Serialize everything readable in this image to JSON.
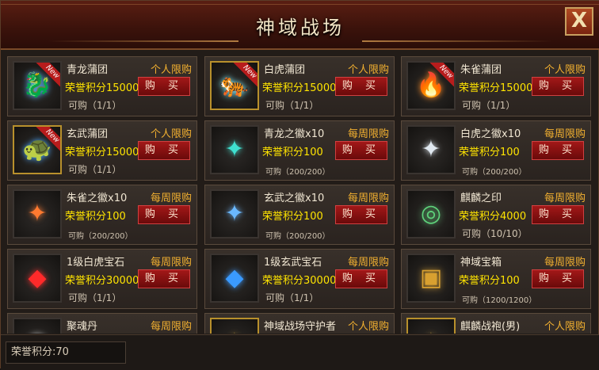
{
  "title": "神域战场",
  "close_label": "X",
  "new_tag": "New",
  "buy_label": "购 买",
  "price_prefix": "荣誉积分",
  "footer": {
    "points_label": "荣誉积分:70"
  },
  "items": [
    {
      "name": "青龙蒲团",
      "limit": "个人限购",
      "price": "150000",
      "avail": "可购（1/1）",
      "new": true,
      "gold": false,
      "icon": "qinglong-icon",
      "glyph": "🐉",
      "color": "#5ab8ff",
      "smallAvail": false
    },
    {
      "name": "白虎蒲团",
      "limit": "个人限购",
      "price": "150000",
      "avail": "可购（1/1）",
      "new": true,
      "gold": true,
      "icon": "baihu-icon",
      "glyph": "🐅",
      "color": "#7ff0ff",
      "smallAvail": false
    },
    {
      "name": "朱雀蒲团",
      "limit": "个人限购",
      "price": "150000",
      "avail": "可购（1/1）",
      "new": true,
      "gold": false,
      "icon": "zhuque-icon",
      "glyph": "🔥",
      "color": "#ff8a20",
      "smallAvail": false
    },
    {
      "name": "玄武蒲团",
      "limit": "个人限购",
      "price": "150000",
      "avail": "可购（1/1）",
      "new": true,
      "gold": true,
      "icon": "xuanwu-icon",
      "glyph": "🐢",
      "color": "#4aa8ff",
      "smallAvail": false
    },
    {
      "name": "青龙之徽x10",
      "limit": "每周限购",
      "price": "100",
      "avail": "可购（200/200）",
      "new": false,
      "gold": false,
      "icon": "qinglong-badge-icon",
      "glyph": "✦",
      "color": "#3fe0d0",
      "smallAvail": true
    },
    {
      "name": "白虎之徽x10",
      "limit": "每周限购",
      "price": "100",
      "avail": "可购（200/200）",
      "new": false,
      "gold": false,
      "icon": "baihu-badge-icon",
      "glyph": "✦",
      "color": "#e0e8f0",
      "smallAvail": true
    },
    {
      "name": "朱雀之徽x10",
      "limit": "每周限购",
      "price": "100",
      "avail": "可购（200/200）",
      "new": false,
      "gold": false,
      "icon": "zhuque-badge-icon",
      "glyph": "✦",
      "color": "#ff7a30",
      "smallAvail": true
    },
    {
      "name": "玄武之徽x10",
      "limit": "每周限购",
      "price": "100",
      "avail": "可购（200/200）",
      "new": false,
      "gold": false,
      "icon": "xuanwu-badge-icon",
      "glyph": "✦",
      "color": "#6ab8ff",
      "smallAvail": true
    },
    {
      "name": "麒麟之印",
      "limit": "每周限购",
      "price": "4000",
      "avail": "可购（10/10）",
      "new": false,
      "gold": false,
      "icon": "qilin-seal-icon",
      "glyph": "◎",
      "color": "#5ed07a",
      "smallAvail": false
    },
    {
      "name": "1级白虎宝石",
      "limit": "每周限购",
      "price": "300000",
      "avail": "可购（1/1）",
      "new": false,
      "gold": false,
      "icon": "red-gem-icon",
      "glyph": "◆",
      "color": "#ff2a2a",
      "smallAvail": false
    },
    {
      "name": "1级玄武宝石",
      "limit": "每周限购",
      "price": "300000",
      "avail": "可购（1/1）",
      "new": false,
      "gold": false,
      "icon": "blue-gem-icon",
      "glyph": "◆",
      "color": "#3a9aff",
      "smallAvail": false
    },
    {
      "name": "神域宝箱",
      "limit": "每周限购",
      "price": "100",
      "avail": "可购（1200/1200）",
      "new": false,
      "gold": false,
      "icon": "treasure-chest-icon",
      "glyph": "▣",
      "color": "#d8a030",
      "smallAvail": true
    },
    {
      "name": "聚魂丹",
      "limit": "每周限购",
      "price": "",
      "avail": "",
      "new": false,
      "gold": false,
      "icon": "pill-icon",
      "glyph": "●",
      "color": "#c8c8c8",
      "smallAvail": false
    },
    {
      "name": "神域战场守护者",
      "limit": "个人限购",
      "price": "",
      "avail": "",
      "new": false,
      "gold": true,
      "icon": "guardian-icon",
      "glyph": "✧",
      "color": "#e0b040",
      "smallAvail": false
    },
    {
      "name": "麒麟战袍(男)",
      "limit": "个人限购",
      "price": "",
      "avail": "",
      "new": false,
      "gold": true,
      "icon": "robe-icon",
      "glyph": "✧",
      "color": "#e0b040",
      "smallAvail": false
    }
  ]
}
